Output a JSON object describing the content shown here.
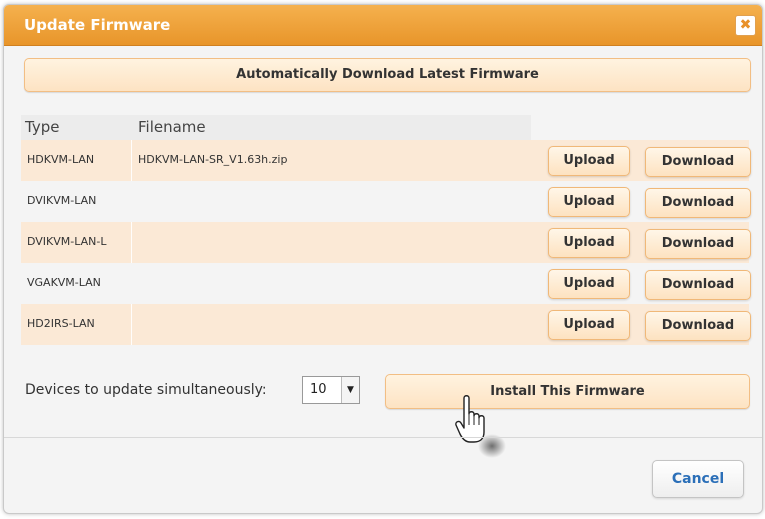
{
  "dialog": {
    "title": "Update Firmware",
    "close_icon": "close-icon",
    "close_symbol": "✖"
  },
  "auto_download": {
    "label": "Automatically Download Latest Firmware"
  },
  "table": {
    "headers": {
      "type": "Type",
      "filename": "Filename"
    },
    "rows": [
      {
        "type": "HDKVM-LAN",
        "filename": "HDKVM-LAN-SR_V1.63h.zip",
        "upload": "Upload",
        "download": "Download"
      },
      {
        "type": "DVIKVM-LAN",
        "filename": "",
        "upload": "Upload",
        "download": "Download"
      },
      {
        "type": "DVIKVM-LAN-L",
        "filename": "",
        "upload": "Upload",
        "download": "Download"
      },
      {
        "type": "VGAKVM-LAN",
        "filename": "",
        "upload": "Upload",
        "download": "Download"
      },
      {
        "type": "HD2IRS-LAN",
        "filename": "",
        "upload": "Upload",
        "download": "Download"
      }
    ]
  },
  "simultaneous": {
    "label": "Devices to update simultaneously:",
    "selected": "10",
    "arrow_symbol": "▼"
  },
  "install": {
    "label": "Install This Firmware"
  },
  "cancel": {
    "label": "Cancel"
  },
  "colors": {
    "title_bar": "#e8952a",
    "button_fill": "#fde3c3",
    "row_alt": "#fbe9d6",
    "link_blue": "#2b6fb8"
  }
}
